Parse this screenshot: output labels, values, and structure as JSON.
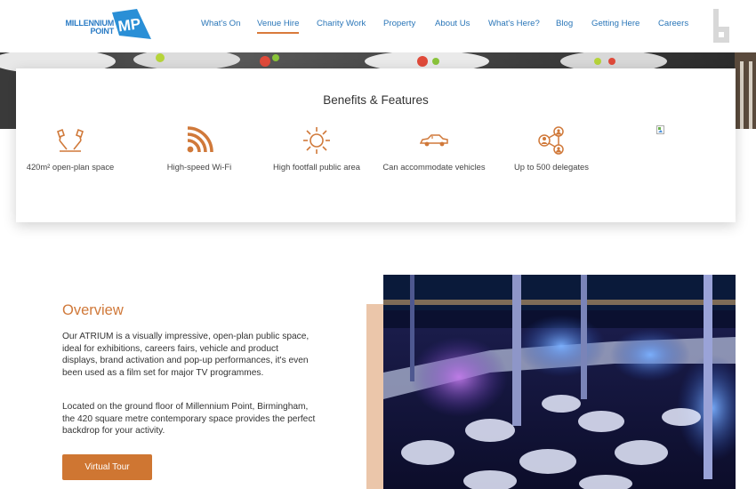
{
  "header": {
    "logo": {
      "line1": "MILLENNIUM",
      "line2": "POINT",
      "mark": "MP"
    },
    "nav": [
      {
        "label": "What's On",
        "active": false
      },
      {
        "label": "Venue Hire",
        "active": true
      },
      {
        "label": "Charity Work",
        "active": false
      },
      {
        "label": "Property",
        "active": false
      },
      {
        "label": "About Us",
        "active": false
      },
      {
        "label": "What's Here?",
        "active": false
      },
      {
        "label": "Blog",
        "active": false
      },
      {
        "label": "Getting Here",
        "active": false
      },
      {
        "label": "Careers",
        "active": false
      }
    ]
  },
  "benefits": {
    "title": "Benefits & Features",
    "items": [
      {
        "icon": "lamps-icon",
        "label": "420m² open-plan space"
      },
      {
        "icon": "wifi-icon",
        "label": "High-speed Wi-Fi"
      },
      {
        "icon": "sun-icon",
        "label": "High footfall public area"
      },
      {
        "icon": "car-icon",
        "label": "Can accommodate vehicles"
      },
      {
        "icon": "people-network-icon",
        "label": "Up to 500 delegates"
      }
    ]
  },
  "overview": {
    "title": "Overview",
    "paragraph1": "Our ATRIUM is a visually impressive, open-plan public space, ideal for exhibitions, careers fairs, vehicle and product displays, brand activation and pop-up performances, it's even been used as a film set for major TV programmes.",
    "paragraph2": "Located on the ground floor of Millennium Point, Birmingham, the 420 square metre contemporary space provides the perfect backdrop for your activity.",
    "button": "Virtual Tour"
  },
  "colors": {
    "accent": "#d0793a",
    "nav_blue": "#2a76b8",
    "button": "#cf7632",
    "accent_bar": "#ebc6aa"
  }
}
